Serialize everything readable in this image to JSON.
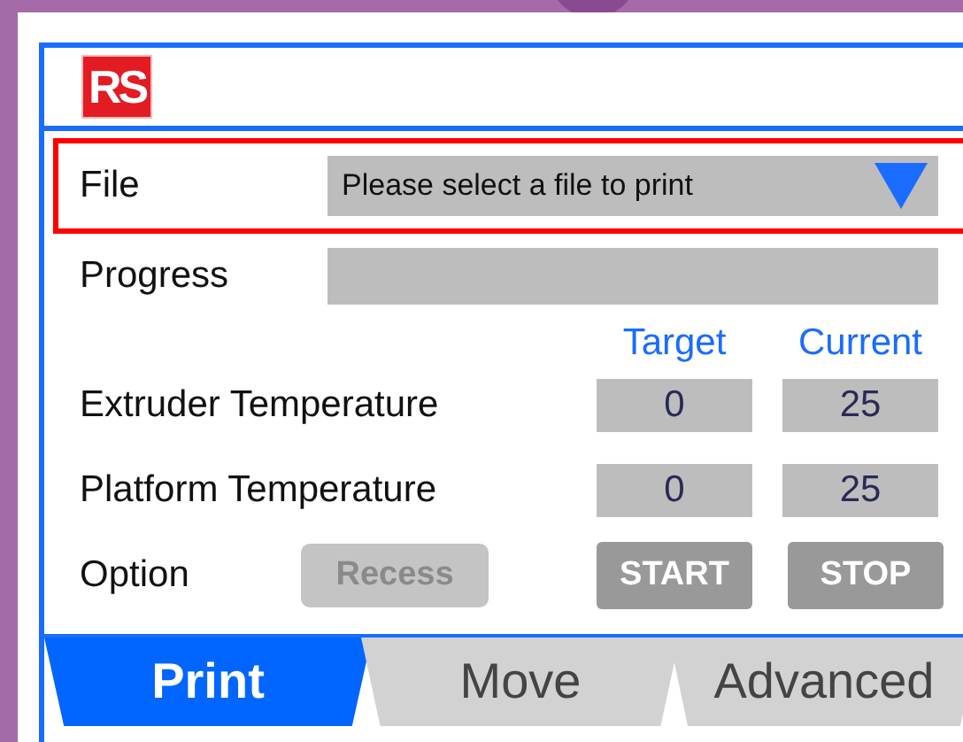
{
  "header": {
    "logo": "RS"
  },
  "file": {
    "label": "File",
    "value": "Please select a file to print"
  },
  "progress": {
    "label": "Progress",
    "level": 0
  },
  "columns": [
    "Target",
    "Current"
  ],
  "temperatures": [
    {
      "label": "Extruder Temperature",
      "target": "0",
      "current": "25"
    },
    {
      "label": "Platform Temperature",
      "target": "0",
      "current": "25"
    }
  ],
  "option": {
    "label": "Option",
    "buttons": [
      {
        "label": "Recess",
        "kind": "option",
        "disabled": true
      },
      {
        "label": "START",
        "kind": "action",
        "disabled": false
      },
      {
        "label": "STOP",
        "kind": "action",
        "disabled": false
      }
    ]
  },
  "tabs": [
    {
      "label": "Print",
      "selected": true
    },
    {
      "label": "Move",
      "selected": false
    },
    {
      "label": "Advanced",
      "selected": false
    }
  ]
}
